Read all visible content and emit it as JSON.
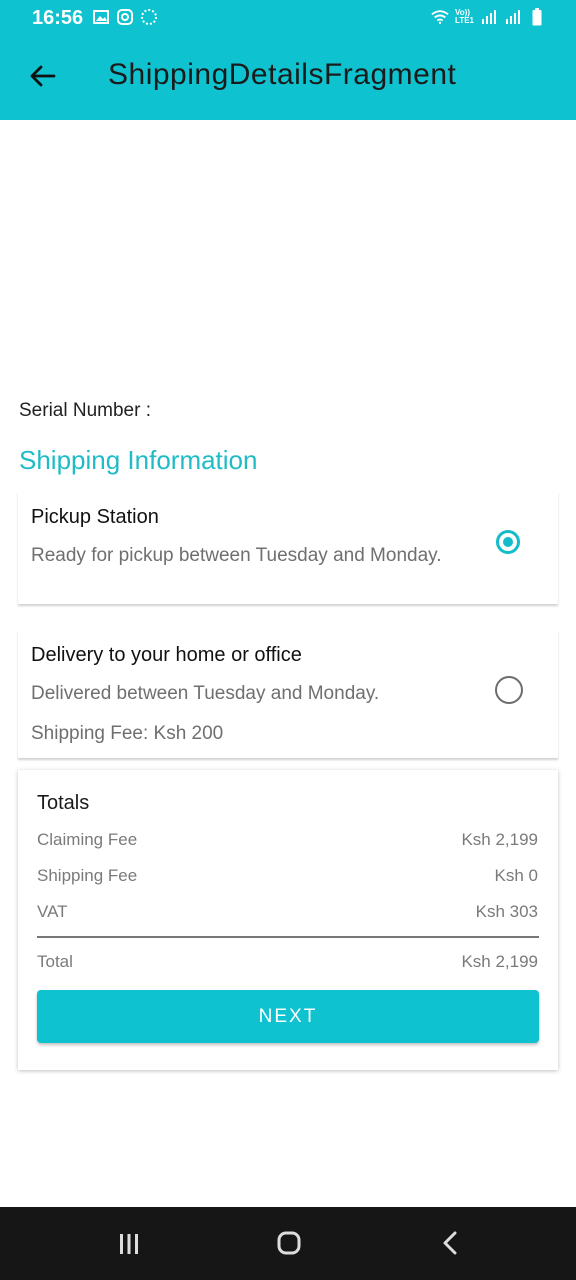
{
  "status_bar": {
    "time": "16:56",
    "icons_left": [
      "gallery-icon",
      "instagram-icon",
      "sync-icon"
    ],
    "icons_right": [
      "wifi-icon",
      "volte-icon",
      "signal-icon",
      "signal-icon-2",
      "battery-icon"
    ],
    "volte_text": "Vo))\nLTE1"
  },
  "app_bar": {
    "title": "ShippingDetailsFragment",
    "back_icon": "arrow-back-icon",
    "color": "#0fc2cf"
  },
  "serial_label": "Serial Number :",
  "section_title": "Shipping Information",
  "options": [
    {
      "title": "Pickup Station",
      "description": "Ready for pickup between Tuesday and Monday.",
      "selected": true
    },
    {
      "title": "Delivery to your home or office",
      "description": "Delivered between Tuesday and Monday.",
      "fee": "Shipping Fee: Ksh 200",
      "selected": false
    }
  ],
  "totals": {
    "title": "Totals",
    "rows": [
      {
        "label": "Claiming Fee",
        "value": "Ksh 2,199"
      },
      {
        "label": "Shipping Fee",
        "value": "Ksh 0"
      },
      {
        "label": "VAT",
        "value": "Ksh 303"
      }
    ],
    "total": {
      "label": "Total",
      "value": "Ksh 2,199"
    },
    "next_label": "NEXT"
  },
  "nav_bar": {
    "icons": [
      "recent-apps-icon",
      "home-icon",
      "back-nav-icon"
    ]
  },
  "colors": {
    "accent": "#0fc2cf",
    "section_title": "#1fbcc8",
    "nav_bar": "#161616"
  }
}
